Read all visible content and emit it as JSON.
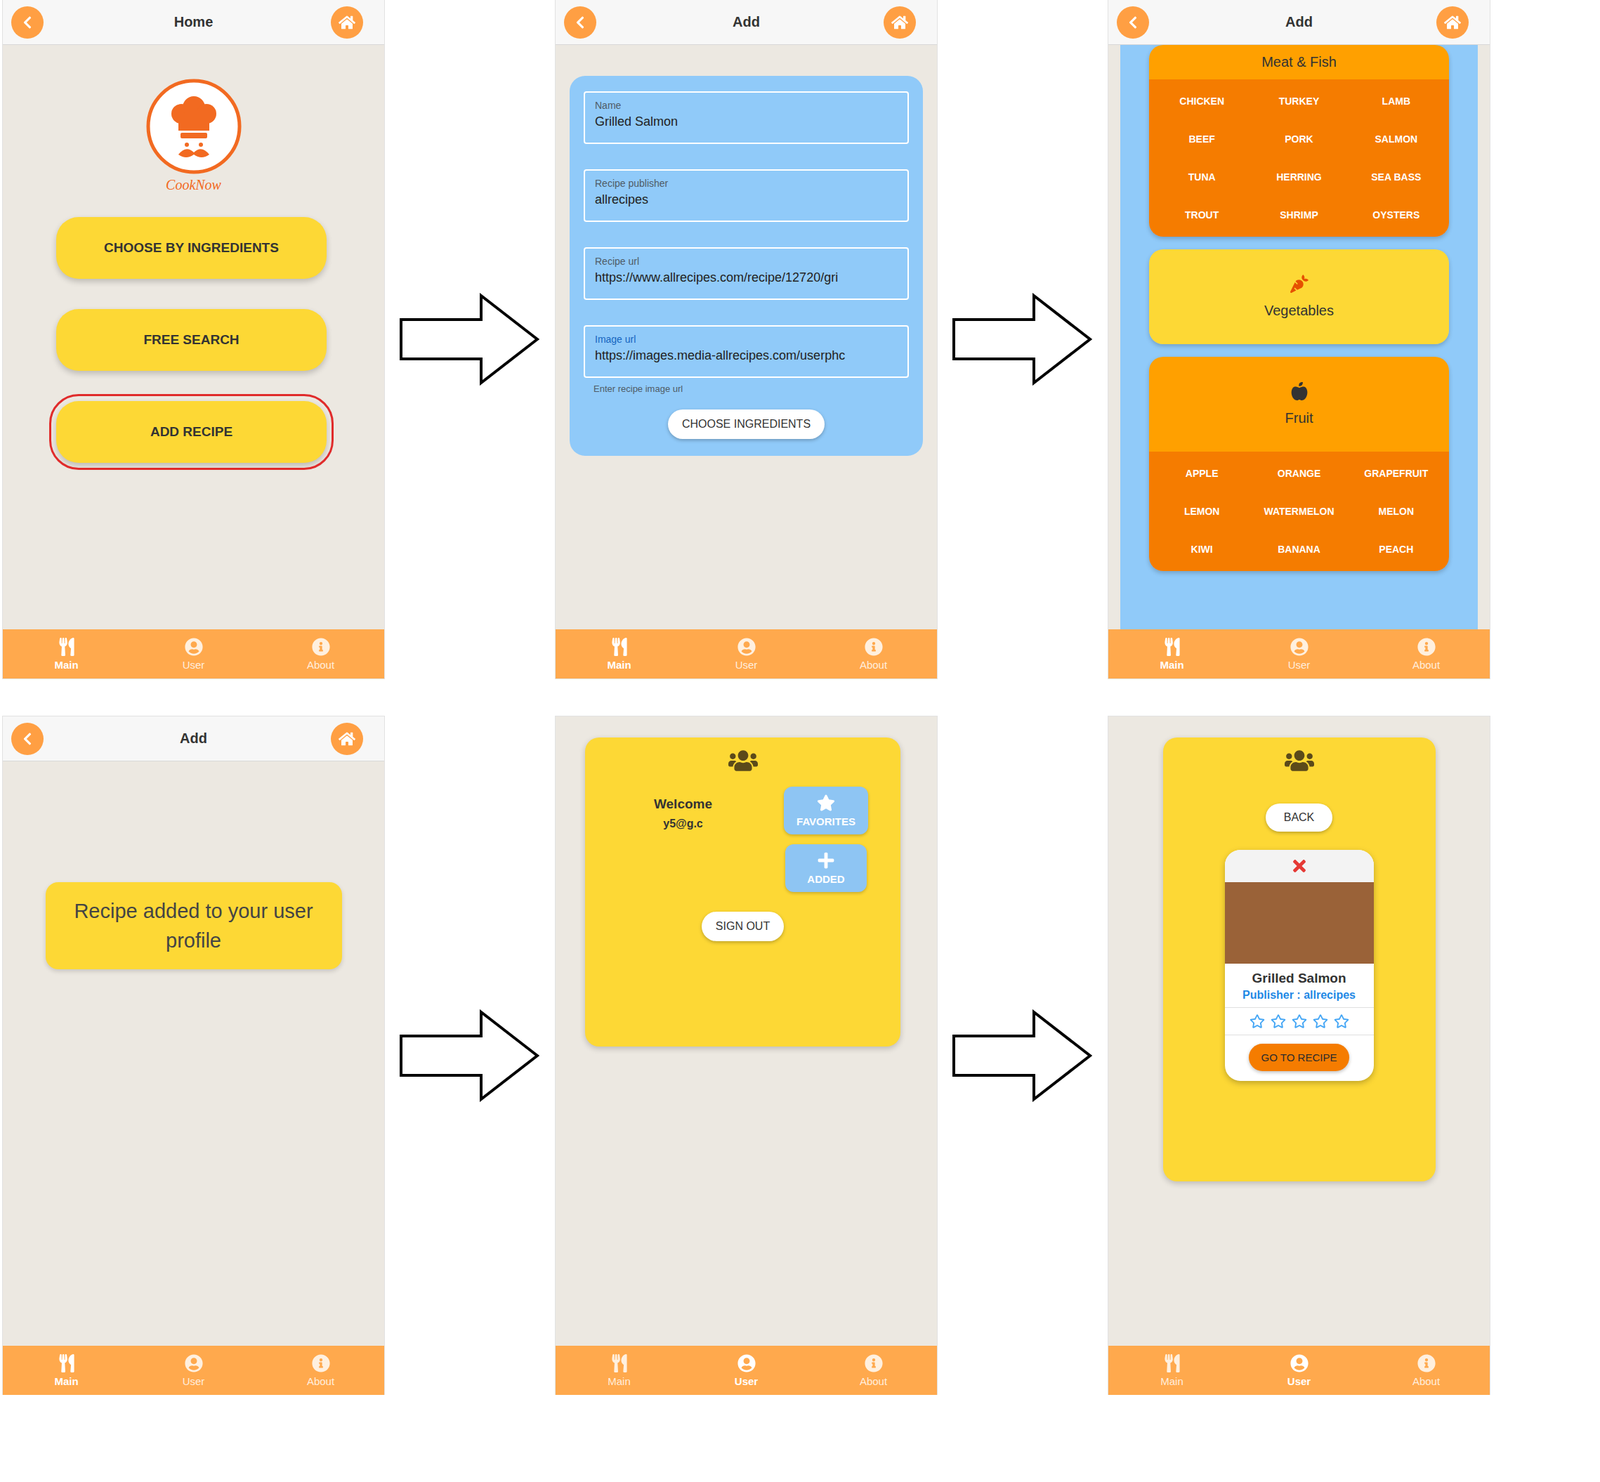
{
  "screens": [
    {
      "kind": "home",
      "header": {
        "title": "Home"
      },
      "logo": "CookNow",
      "menu": [
        {
          "label": "CHOOSE BY INGREDIENTS",
          "selected": false
        },
        {
          "label": "FREE SEARCH",
          "selected": false
        },
        {
          "label": "ADD RECIPE",
          "selected": true
        }
      ],
      "nav": [
        {
          "label": "Main",
          "selected": true
        },
        {
          "label": "User",
          "selected": false
        },
        {
          "label": "About",
          "selected": false
        }
      ]
    },
    {
      "kind": "form",
      "header": {
        "title": "Add"
      },
      "fields": [
        {
          "label": "Name",
          "value": "Grilled Salmon",
          "focused": false
        },
        {
          "label": "Recipe publisher",
          "value": "allrecipes",
          "focused": false
        },
        {
          "label": "Recipe url",
          "value": "https://www.allrecipes.com/recipe/12720/gri",
          "focused": false
        },
        {
          "label": "Image url",
          "value": "https://images.media-allrecipes.com/userphc",
          "focused": true
        }
      ],
      "helper": "Enter recipe image url",
      "button": "CHOOSE INGREDIENTS",
      "nav": [
        {
          "label": "Main",
          "selected": true
        },
        {
          "label": "User",
          "selected": false
        },
        {
          "label": "About",
          "selected": false
        }
      ]
    },
    {
      "kind": "categories",
      "header": {
        "title": "Add"
      },
      "categories": [
        {
          "name": "Meat & Fish",
          "expanded": true,
          "items": [
            "CHICKEN",
            "TURKEY",
            "LAMB",
            "BEEF",
            "PORK",
            "SALMON",
            "TUNA",
            "HERRING",
            "SEA BASS",
            "TROUT",
            "SHRIMP",
            "OYSTERS"
          ]
        },
        {
          "name": "Vegetables",
          "expanded": false,
          "items": []
        },
        {
          "name": "Fruit",
          "expanded": true,
          "items": [
            "APPLE",
            "ORANGE",
            "GRAPEFRUIT",
            "LEMON",
            "WATERMELON",
            "MELON",
            "KIWI",
            "BANANA",
            "PEACH"
          ]
        }
      ],
      "nav": [
        {
          "label": "Main",
          "selected": true
        },
        {
          "label": "User",
          "selected": false
        },
        {
          "label": "About",
          "selected": false
        }
      ]
    },
    {
      "kind": "message",
      "header": {
        "title": "Add"
      },
      "message": "Recipe added to your user profile",
      "nav": [
        {
          "label": "Main",
          "selected": true
        },
        {
          "label": "User",
          "selected": false
        },
        {
          "label": "About",
          "selected": false
        }
      ]
    },
    {
      "kind": "user",
      "welcome": "Welcome",
      "email": "y5@g.c",
      "buttons": [
        {
          "label": "FAVORITES"
        },
        {
          "label": "ADDED"
        }
      ],
      "signout": "SIGN OUT",
      "nav": [
        {
          "label": "Main",
          "selected": false
        },
        {
          "label": "User",
          "selected": true
        },
        {
          "label": "About",
          "selected": false
        }
      ]
    },
    {
      "kind": "recipe",
      "back": "BACK",
      "recipe": {
        "name": "Grilled Salmon",
        "publisher": "Publisher : allrecipes",
        "stars": 0,
        "action": "GO TO RECIPE"
      },
      "nav": [
        {
          "label": "Main",
          "selected": false
        },
        {
          "label": "User",
          "selected": true
        },
        {
          "label": "About",
          "selected": false
        }
      ]
    }
  ]
}
